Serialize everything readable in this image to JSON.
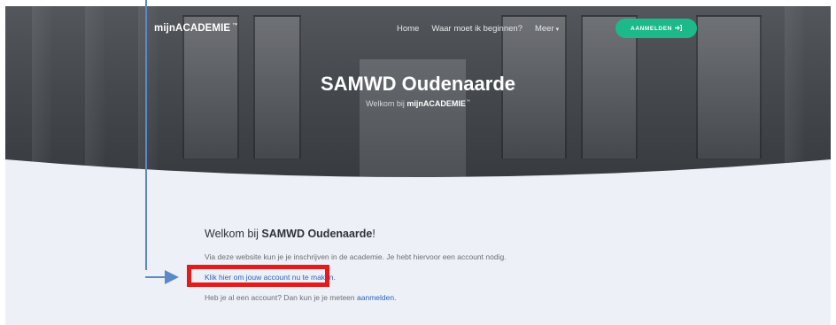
{
  "nav": {
    "brand": "mijnACADEMIE",
    "brand_tm": "™",
    "links": [
      "Home",
      "Waar moet ik beginnen?",
      "Meer"
    ],
    "more_caret": "▾",
    "login_label": "AANMELDEN",
    "login_icon": "sign-in-icon"
  },
  "hero": {
    "title": "SAMWD Oudenaarde",
    "subtitle_prefix": "Welkom bij ",
    "subtitle_brand": "mijnACADEMIE",
    "subtitle_tm": "™"
  },
  "main": {
    "welcome_prefix": "Welkom bij ",
    "welcome_name": "SAMWD Oudenaarde",
    "welcome_suffix": "!",
    "intro": "Via deze website kun je je inschrijven in de academie. Je hebt hiervoor een account nodig.",
    "create_account_link": "Klik hier om jouw account nu te maken.",
    "login_prefix": "Heb je al een account? Dan kun je je meteen ",
    "login_link": "aanmelden",
    "login_suffix": "."
  },
  "colors": {
    "accent_button": "#1db98a",
    "link": "#2a62c0",
    "annotation_box": "#e51a1a",
    "annotation_arrow": "#5b88c6"
  }
}
